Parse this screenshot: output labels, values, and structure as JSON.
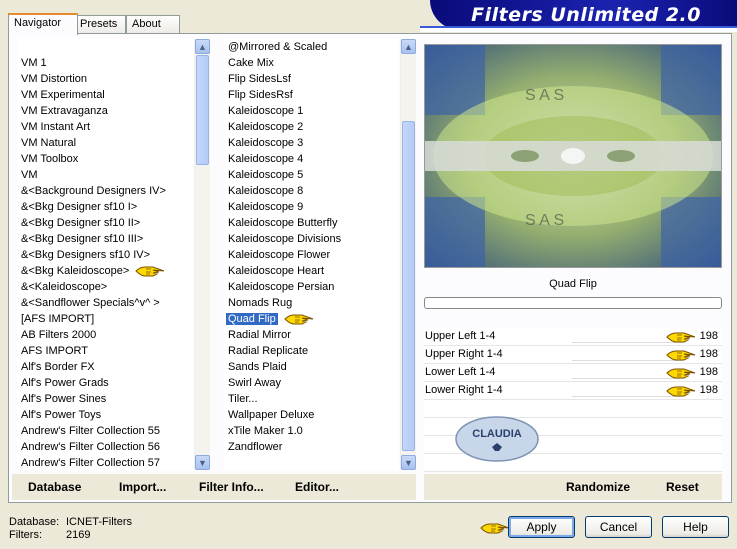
{
  "banner": {
    "title": "Filters Unlimited 2.0"
  },
  "tabs": [
    {
      "label": "Navigator",
      "active": true
    },
    {
      "label": "Presets",
      "active": false
    },
    {
      "label": "About",
      "active": false
    }
  ],
  "categories": [
    "VM 1",
    "VM Distortion",
    "VM Experimental",
    "VM Extravaganza",
    "VM Instant Art",
    "VM Natural",
    "VM Toolbox",
    "VM",
    "&<Background Designers IV>",
    "&<Bkg Designer sf10 I>",
    "&<Bkg Designer sf10 II>",
    "&<Bkg Designer sf10 III>",
    "&<Bkg Designers sf10 IV>",
    "&<Bkg Kaleidoscope>",
    "&<Kaleidoscope>",
    "&<Sandflower Specials^v^ >",
    "[AFS IMPORT]",
    "AB Filters 2000",
    "AFS IMPORT",
    "Alf's Border FX",
    "Alf's Power Grads",
    "Alf's Power Sines",
    "Alf's Power Toys",
    "Andrew's Filter Collection 55",
    "Andrew's Filter Collection 56",
    "Andrew's Filter Collection 57"
  ],
  "filters": [
    "@Mirrored & Scaled",
    "Cake Mix",
    "Flip SidesLsf",
    "Flip SidesRsf",
    "Kaleidoscope 1",
    "Kaleidoscope 2",
    "Kaleidoscope 3",
    "Kaleidoscope 4",
    "Kaleidoscope 5",
    "Kaleidoscope 8",
    "Kaleidoscope 9",
    "Kaleidoscope Butterfly",
    "Kaleidoscope Divisions",
    "Kaleidoscope Flower",
    "Kaleidoscope Heart",
    "Kaleidoscope Persian",
    "Nomads Rug",
    "Quad Flip",
    "Radial Mirror",
    "Radial Replicate",
    "Sands Plaid",
    "Swirl Away",
    "Tiler...",
    "Wallpaper Deluxe",
    "xTile Maker 1.0",
    "Zandflower"
  ],
  "selected_filter": "Quad Flip",
  "progress": 0,
  "params": [
    {
      "label": "Upper Left 1-4",
      "value": "198"
    },
    {
      "label": "Upper Right 1-4",
      "value": "198"
    },
    {
      "label": "Lower Left 1-4",
      "value": "198"
    },
    {
      "label": "Lower Right 1-4",
      "value": "198"
    }
  ],
  "watermark": {
    "text": "CLAUDIA"
  },
  "left_buttons": {
    "database": "Database",
    "import": "Import...",
    "filter_info": "Filter Info...",
    "editor": "Editor..."
  },
  "right_buttons": {
    "randomize": "Randomize",
    "reset": "Reset"
  },
  "status": {
    "database_label": "Database:",
    "database_value": "ICNET-Filters",
    "filters_label": "Filters:",
    "filters_value": "2169"
  },
  "dialog_buttons": {
    "apply": "Apply",
    "cancel": "Cancel",
    "help": "Help"
  },
  "colors": {
    "selection": "#316ac5",
    "banner": "#0a0a7a",
    "tab_accent": "#e68b2c"
  }
}
